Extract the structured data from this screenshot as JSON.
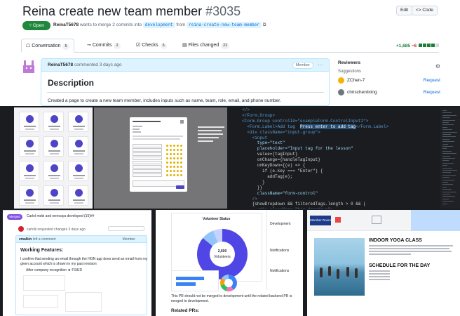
{
  "pr": {
    "title": "Reina create new team member",
    "number": "#3035",
    "edit_label": "Edit",
    "code_label": "<> Code",
    "status": "Open",
    "author": "ReinaT5678",
    "merge_text": "wants to merge 2 commits into",
    "base_branch": "development",
    "from_text": "from",
    "head_branch": "reina-create-new-team-member",
    "tabs": [
      {
        "label": "Conversation",
        "count": "5"
      },
      {
        "label": "Commits",
        "count": "2"
      },
      {
        "label": "Checks",
        "count": "6"
      },
      {
        "label": "Files changed",
        "count": "22"
      }
    ],
    "diff_add": "+1,685",
    "diff_del": "−6"
  },
  "comment": {
    "author": "ReinaT5678",
    "meta": "commented 3 days ago",
    "badge": "Member",
    "more": "···",
    "heading": "Description",
    "body": "Created a page to create a new team member, includes inputs such as name, team, role, email, and phone number."
  },
  "sidebar": {
    "title": "Reviewers",
    "subtitle": "Suggestions",
    "reviewers": [
      {
        "name": "ZChen-7",
        "action": "Request",
        "color": "#f4b400"
      },
      {
        "name": "chrischenlixing",
        "action": "Request",
        "color": "#6e7781"
      }
    ]
  },
  "code": {
    "lines": [
      {
        "n": "",
        "t": "  </>"
      },
      {
        "n": "",
        "t": "  </Form.Group>"
      },
      {
        "n": "",
        "t": "  <Form.Group controlId=\"exampleForm.ControlInput1\">"
      },
      {
        "n": "",
        "t": "    <Form.Label>Add tag  Press enter to add tag</Form.Label>"
      },
      {
        "n": "",
        "t": "    <div className=\"input-group\">"
      },
      {
        "n": "",
        "t": "      <input"
      },
      {
        "n": "",
        "t": "        type=\"text\""
      },
      {
        "n": "",
        "t": "        placeholder=\"Input tag for the lesson\""
      },
      {
        "n": "",
        "t": "        value={tagInput}"
      },
      {
        "n": "",
        "t": "        onChange={handleTagInput}"
      },
      {
        "n": "",
        "t": "        onKeyDown={(e) => {"
      },
      {
        "n": "",
        "t": "          if (e.key === \"Enter\") {"
      },
      {
        "n": "",
        "t": "            addTag(e);"
      },
      {
        "n": "",
        "t": "          }"
      },
      {
        "n": "",
        "t": "        }}"
      },
      {
        "n": "",
        "t": "        className=\"form-control\""
      },
      {
        "n": "",
        "t": "      />"
      },
      {
        "n": "",
        "t": "      {showDropdown && filteredTags.length > 0 && ("
      },
      {
        "n": "",
        "t": "        <div className=\"tag-dropdown\">"
      }
    ]
  },
  "bottom1": {
    "merged": "Merged",
    "title_line": "Carlol mobi and wenvaya developed (15)##",
    "sub_line": "carlolii requested changes 3 days ago",
    "box_author": "zmalkin",
    "box_meta": "left a comment",
    "box_badge": "Member",
    "heading": "Working Features:",
    "lines": [
      "I confirm that sending an email through the HGN app does send an email from my",
      "given account which is shown in my past revision",
      "After company recognition  ★  FIXED"
    ]
  },
  "bottom2": {
    "chart_title": "Volunteer Status",
    "center_value": "2,600",
    "center_label": "Volunteers",
    "footer": "This PR should not be merged to development until the related backend PR is merged to development.",
    "related": "Related PRs:",
    "side_labels": [
      "Development",
      "Notifications",
      "Notifications"
    ]
  },
  "bottom3": {
    "brand": "Member Room",
    "heading1": "INDOOR YOGA CLASS",
    "heading2": "SCHEDULE FOR THE DAY"
  }
}
